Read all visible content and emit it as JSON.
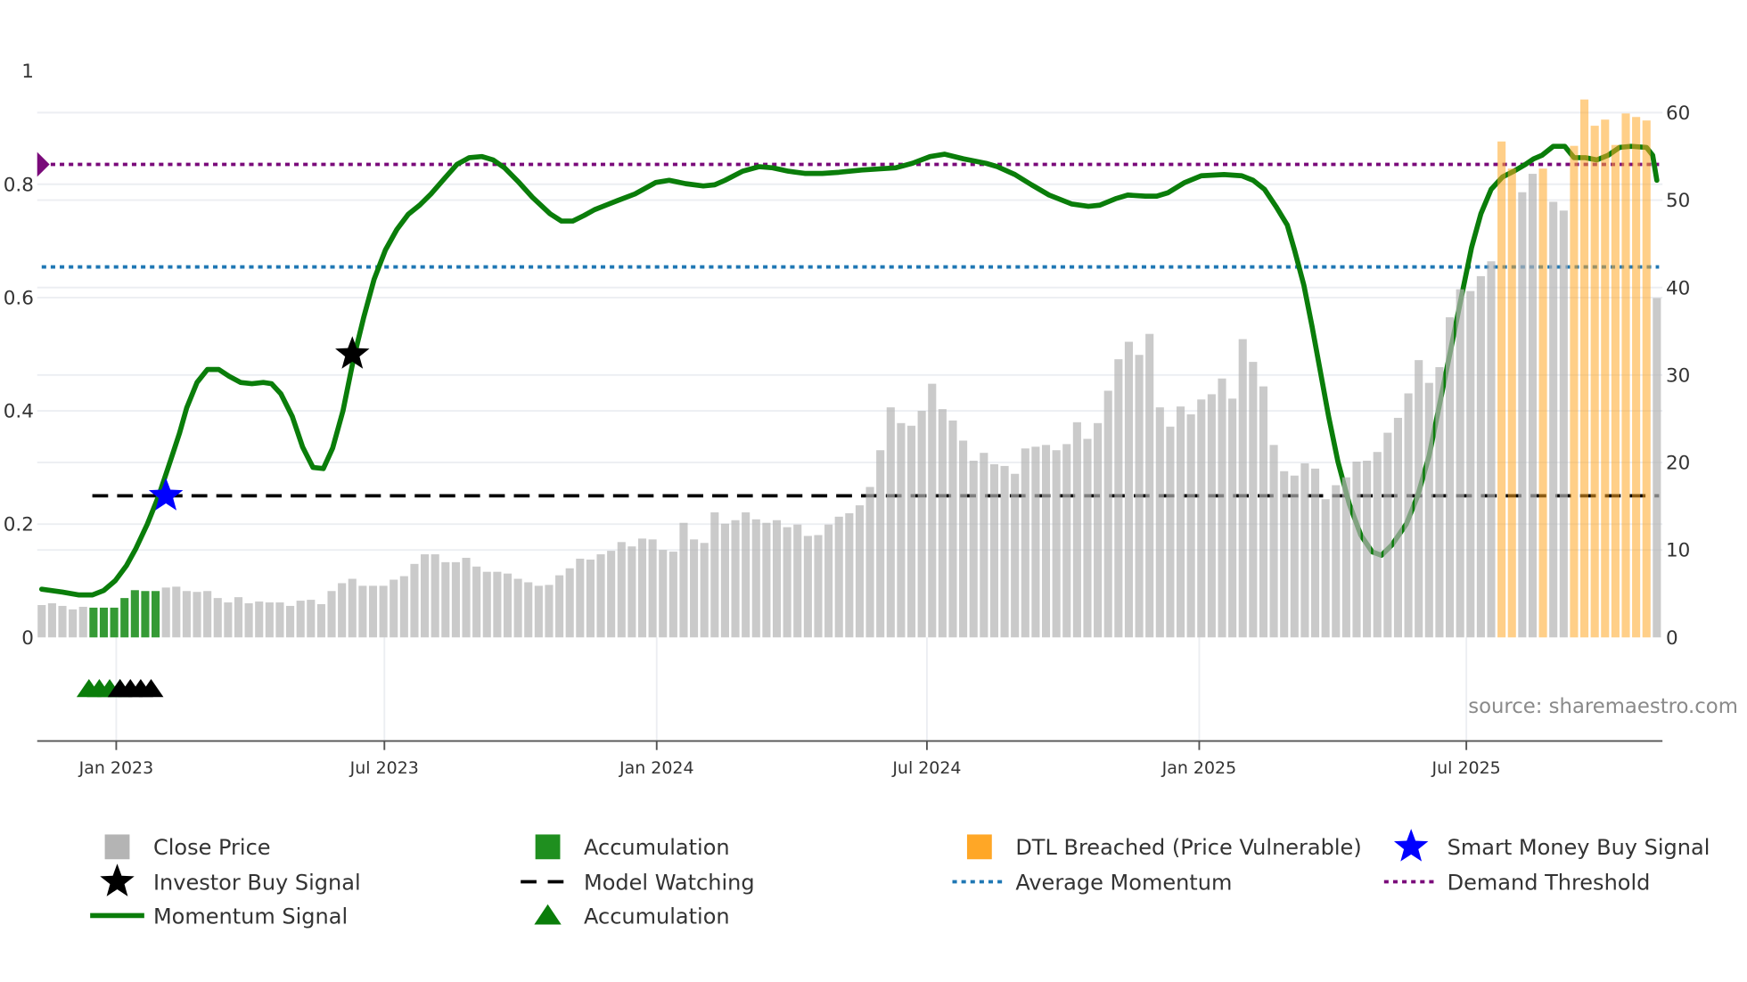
{
  "chart_data": {
    "type": "bar+line",
    "title": "",
    "source": "source: sharemaestro.com",
    "start_date": "2022-11-11",
    "bar_interval": "weekly",
    "left_axis": {
      "label": "",
      "ylim": [
        0,
        1
      ],
      "ticks": [
        "0",
        "0.2",
        "0.4",
        "0.6",
        "0.8",
        "1"
      ],
      "tick_values": [
        0,
        0.2,
        0.4,
        0.6,
        0.8,
        1
      ]
    },
    "right_axis": {
      "label": "",
      "ylim": [
        0,
        60
      ],
      "ticks": [
        "0",
        "10",
        "20",
        "30",
        "40",
        "50",
        "60"
      ],
      "tick_values": [
        0,
        10,
        20,
        30,
        40,
        50,
        60
      ]
    },
    "x_ticks": [
      {
        "label": "Jan 2023",
        "week": 7.2
      },
      {
        "label": "Jul 2023",
        "week": 33.1
      },
      {
        "label": "Jan 2024",
        "week": 59.4
      },
      {
        "label": "Jul 2024",
        "week": 85.5
      },
      {
        "label": "Jan 2025",
        "week": 111.8
      },
      {
        "label": "Jul 2025",
        "week": 137.6
      }
    ],
    "close_price": [
      3.7,
      3.9,
      3.6,
      3.2,
      3.5,
      3.4,
      3.4,
      3.4,
      4.5,
      5.4,
      5.3,
      5.3,
      5.7,
      5.8,
      5.3,
      5.2,
      5.3,
      4.5,
      4.0,
      4.6,
      3.9,
      4.1,
      4.0,
      4.0,
      3.6,
      4.2,
      4.3,
      3.8,
      5.3,
      6.2,
      6.7,
      5.9,
      5.9,
      5.9,
      6.6,
      7.0,
      8.4,
      9.5,
      9.5,
      8.6,
      8.6,
      9.1,
      8.1,
      7.5,
      7.5,
      7.3,
      6.7,
      6.3,
      5.9,
      6.0,
      7.1,
      7.9,
      9.0,
      8.9,
      9.5,
      9.9,
      10.9,
      10.4,
      11.3,
      11.2,
      10.0,
      9.8,
      13.1,
      11.2,
      10.8,
      14.3,
      13.0,
      13.4,
      14.3,
      13.5,
      13.1,
      13.4,
      12.6,
      12.9,
      11.6,
      11.7,
      12.9,
      13.8,
      14.2,
      15.1,
      17.2,
      21.4,
      26.3,
      24.5,
      24.2,
      25.9,
      29.0,
      26.1,
      24.8,
      22.5,
      20.2,
      21.1,
      19.8,
      19.6,
      18.7,
      21.6,
      21.8,
      22.0,
      21.4,
      22.1,
      24.6,
      22.7,
      24.5,
      28.2,
      31.8,
      33.8,
      32.3,
      34.7,
      26.3,
      24.1,
      26.4,
      25.5,
      27.2,
      27.8,
      29.6,
      27.3,
      34.1,
      31.5,
      28.7,
      22.0,
      19.0,
      18.5,
      19.9,
      19.3,
      15.8,
      17.4,
      18.3,
      20.1,
      20.2,
      21.2,
      23.4,
      25.1,
      27.9,
      31.7,
      29.1,
      30.9,
      36.6,
      39.8,
      39.6,
      41.3,
      43.0,
      56.7,
      53.6,
      50.9,
      53.0,
      53.6,
      49.8,
      48.8,
      56.2,
      61.5,
      58.5,
      59.2,
      56.3,
      59.9,
      59.5,
      59.1,
      38.8
    ],
    "accumulation_bar_indices": [
      5,
      6,
      7,
      8,
      9,
      10,
      11
    ],
    "dtl_breached_bar_indices": [
      141,
      142,
      145,
      148,
      149,
      150,
      151,
      152,
      153,
      154,
      155
    ],
    "momentum": [
      [
        0,
        0.085
      ],
      [
        2,
        0.08
      ],
      [
        3.6,
        0.075
      ],
      [
        4.9,
        0.075
      ],
      [
        6,
        0.083
      ],
      [
        7.1,
        0.1
      ],
      [
        8.2,
        0.127
      ],
      [
        9.1,
        0.157
      ],
      [
        10.2,
        0.2
      ],
      [
        11.3,
        0.25
      ],
      [
        12.4,
        0.31
      ],
      [
        13.3,
        0.36
      ],
      [
        14,
        0.405
      ],
      [
        15,
        0.45
      ],
      [
        16,
        0.473
      ],
      [
        17.1,
        0.473
      ],
      [
        18.1,
        0.461
      ],
      [
        19.2,
        0.45
      ],
      [
        20.3,
        0.448
      ],
      [
        21.4,
        0.45
      ],
      [
        22.2,
        0.448
      ],
      [
        23.1,
        0.43
      ],
      [
        24.2,
        0.39
      ],
      [
        25.2,
        0.336
      ],
      [
        26.2,
        0.3
      ],
      [
        27.2,
        0.298
      ],
      [
        28.1,
        0.334
      ],
      [
        29.1,
        0.4
      ],
      [
        30.1,
        0.49
      ],
      [
        31.1,
        0.565
      ],
      [
        32.1,
        0.632
      ],
      [
        33.2,
        0.684
      ],
      [
        34.3,
        0.72
      ],
      [
        35.4,
        0.747
      ],
      [
        36.5,
        0.763
      ],
      [
        37.6,
        0.783
      ],
      [
        38.9,
        0.81
      ],
      [
        40.1,
        0.835
      ],
      [
        41.3,
        0.847
      ],
      [
        42.5,
        0.849
      ],
      [
        43.6,
        0.843
      ],
      [
        44.7,
        0.829
      ],
      [
        46,
        0.805
      ],
      [
        47.4,
        0.777
      ],
      [
        49.1,
        0.748
      ],
      [
        50.2,
        0.735
      ],
      [
        51.3,
        0.735
      ],
      [
        52.4,
        0.745
      ],
      [
        53.4,
        0.755
      ],
      [
        54.5,
        0.763
      ],
      [
        55.6,
        0.771
      ],
      [
        57.3,
        0.783
      ],
      [
        59.3,
        0.803
      ],
      [
        60.6,
        0.807
      ],
      [
        62.2,
        0.801
      ],
      [
        63.9,
        0.797
      ],
      [
        65,
        0.799
      ],
      [
        66,
        0.807
      ],
      [
        67.7,
        0.823
      ],
      [
        69.3,
        0.831
      ],
      [
        70.6,
        0.829
      ],
      [
        72.1,
        0.823
      ],
      [
        73.7,
        0.819
      ],
      [
        75.4,
        0.819
      ],
      [
        77,
        0.821
      ],
      [
        79.2,
        0.825
      ],
      [
        82.5,
        0.829
      ],
      [
        84.1,
        0.837
      ],
      [
        85.8,
        0.849
      ],
      [
        87.2,
        0.853
      ],
      [
        89,
        0.845
      ],
      [
        91.2,
        0.837
      ],
      [
        92.3,
        0.831
      ],
      [
        94,
        0.817
      ],
      [
        95.6,
        0.799
      ],
      [
        97.3,
        0.781
      ],
      [
        99.5,
        0.765
      ],
      [
        101.1,
        0.761
      ],
      [
        102.2,
        0.763
      ],
      [
        103.8,
        0.775
      ],
      [
        104.9,
        0.781
      ],
      [
        106.6,
        0.779
      ],
      [
        107.7,
        0.779
      ],
      [
        108.8,
        0.785
      ],
      [
        110.4,
        0.803
      ],
      [
        112,
        0.815
      ],
      [
        114.2,
        0.817
      ],
      [
        115.9,
        0.815
      ],
      [
        117,
        0.807
      ],
      [
        118.1,
        0.791
      ],
      [
        119.2,
        0.761
      ],
      [
        120.3,
        0.728
      ],
      [
        121,
        0.684
      ],
      [
        121.9,
        0.622
      ],
      [
        122.7,
        0.549
      ],
      [
        123.5,
        0.469
      ],
      [
        124.3,
        0.39
      ],
      [
        125.2,
        0.31
      ],
      [
        126.3,
        0.235
      ],
      [
        127.4,
        0.181
      ],
      [
        128.5,
        0.151
      ],
      [
        129.4,
        0.145
      ],
      [
        130.4,
        0.163
      ],
      [
        131.8,
        0.2
      ],
      [
        132.9,
        0.25
      ],
      [
        134,
        0.32
      ],
      [
        135,
        0.41
      ],
      [
        136.1,
        0.509
      ],
      [
        137.2,
        0.608
      ],
      [
        138.1,
        0.688
      ],
      [
        139,
        0.748
      ],
      [
        140,
        0.791
      ],
      [
        141.1,
        0.813
      ],
      [
        142.2,
        0.823
      ],
      [
        143.3,
        0.835
      ],
      [
        144.1,
        0.845
      ],
      [
        144.9,
        0.851
      ],
      [
        146,
        0.867
      ],
      [
        147.1,
        0.867
      ],
      [
        148,
        0.847
      ],
      [
        149.1,
        0.847
      ],
      [
        150.2,
        0.843
      ],
      [
        151.3,
        0.851
      ],
      [
        152.4,
        0.865
      ],
      [
        153.5,
        0.867
      ],
      [
        155,
        0.865
      ],
      [
        155.6,
        0.851
      ],
      [
        156,
        0.807
      ]
    ],
    "average_momentum": 0.654,
    "demand_threshold": 0.835,
    "model_watching": {
      "level": 0.25,
      "from_week": 5
    },
    "smart_money_buy_signals": [
      {
        "week": 12,
        "value": 0.25
      }
    ],
    "investor_buy_signals": [
      {
        "week": 30,
        "value": 0.5
      }
    ],
    "accumulation_markers": [
      5,
      6,
      7,
      8
    ],
    "investor_buy_markers": [
      8,
      9,
      10,
      11
    ],
    "legend": [
      {
        "label": "Close Price",
        "symbol": "square",
        "color": "#b4b4b4"
      },
      {
        "label": "Accumulation",
        "symbol": "square",
        "color": "#1f8f1f"
      },
      {
        "label": "DTL Breached (Price Vulnerable)",
        "symbol": "square",
        "color": "#ffa726"
      },
      {
        "label": "Smart Money Buy Signal",
        "symbol": "star",
        "color": "#0000ff"
      },
      {
        "label": "Investor Buy Signal",
        "symbol": "star",
        "color": "#000000"
      },
      {
        "label": "Model Watching",
        "symbol": "dash",
        "color": "#000000"
      },
      {
        "label": "Average Momentum",
        "symbol": "dot",
        "color": "#1f77b4"
      },
      {
        "label": "Demand Threshold",
        "symbol": "dot",
        "color": "#7a0a7a"
      },
      {
        "label": "Momentum Signal",
        "symbol": "line",
        "color": "#0a7d0a"
      },
      {
        "label": "Accumulation",
        "symbol": "triangle",
        "color": "#0a7d0a"
      }
    ],
    "legend_placement": "bottom"
  }
}
